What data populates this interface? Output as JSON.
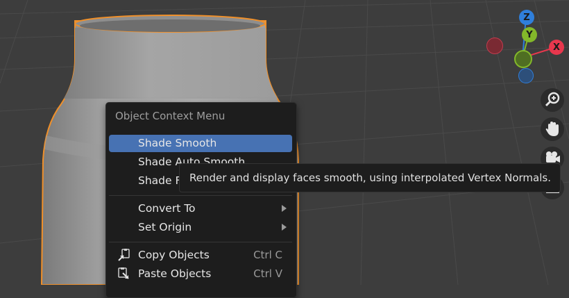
{
  "context_menu": {
    "title": "Object Context Menu",
    "items": [
      {
        "label": "Shade Smooth",
        "active": true
      },
      {
        "label": "Shade Auto Smooth"
      },
      {
        "label": "Shade Flat"
      },
      {
        "label": "Convert To",
        "submenu": true
      },
      {
        "label": "Set Origin",
        "submenu": true
      },
      {
        "label": "Copy Objects",
        "shortcut": "Ctrl C",
        "icon": "copy-icon"
      },
      {
        "label": "Paste Objects",
        "shortcut": "Ctrl V",
        "icon": "paste-icon"
      }
    ]
  },
  "tooltip": {
    "text": "Render and display faces smooth, using interpolated Vertex Normals."
  },
  "gizmo": {
    "labels": {
      "z": "Z",
      "y": "Y",
      "x": "X"
    },
    "colors": {
      "x": "#e8374d",
      "y": "#83b82a",
      "z": "#2f7fdb"
    }
  },
  "nav_icons": [
    "zoom-icon",
    "pan-hand-icon",
    "camera-icon",
    "grid-icon"
  ],
  "colors": {
    "background": "#3d3d3d",
    "menu_bg": "#1d1d1d",
    "highlight": "#4772b3",
    "selection_outline": "#f0902a"
  }
}
